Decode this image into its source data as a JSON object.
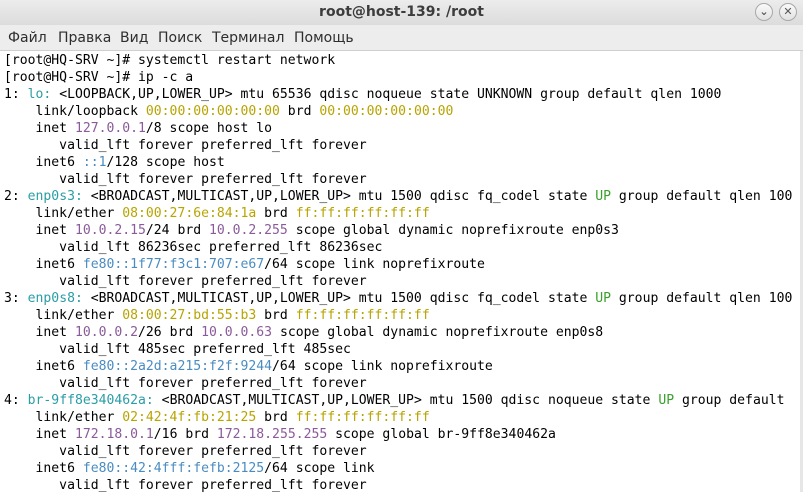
{
  "window": {
    "title": "root@host-139: /root"
  },
  "menu": [
    "Файл",
    "Правка",
    "Вид",
    "Поиск",
    "Терминал",
    "Помощь"
  ],
  "terminal": {
    "lines": [
      [
        [
          "",
          "[root@HQ-SRV ~]# systemctl restart network"
        ]
      ],
      [
        [
          "",
          "[root@HQ-SRV ~]# ip -c a"
        ]
      ],
      [
        [
          "",
          "1: "
        ],
        [
          "teal",
          "lo:"
        ],
        [
          "",
          " <LOOPBACK,UP,LOWER_UP> mtu 65536 qdisc noqueue state UNKNOWN group default qlen 1000"
        ]
      ],
      [
        [
          "",
          "    link/loopback "
        ],
        [
          "yellow",
          "00:00:00:00:00:00"
        ],
        [
          "",
          " brd "
        ],
        [
          "yellow",
          "00:00:00:00:00:00"
        ]
      ],
      [
        [
          "",
          "    inet "
        ],
        [
          "purple",
          "127.0.0.1"
        ],
        [
          "",
          "/8 scope host lo"
        ]
      ],
      [
        [
          "",
          "       valid_lft forever preferred_lft forever"
        ]
      ],
      [
        [
          "",
          "    inet6 "
        ],
        [
          "blue",
          "::1"
        ],
        [
          "",
          "/128 scope host"
        ]
      ],
      [
        [
          "",
          "       valid_lft forever preferred_lft forever"
        ]
      ],
      [
        [
          "",
          "2: "
        ],
        [
          "teal",
          "enp0s3:"
        ],
        [
          "",
          " <BROADCAST,MULTICAST,UP,LOWER_UP> mtu 1500 qdisc fq_codel state "
        ],
        [
          "green",
          "UP"
        ],
        [
          "",
          " group default qlen 100"
        ]
      ],
      [
        [
          "",
          "    link/ether "
        ],
        [
          "yellow",
          "08:00:27:6e:84:1a"
        ],
        [
          "",
          " brd "
        ],
        [
          "yellow",
          "ff:ff:ff:ff:ff:ff"
        ]
      ],
      [
        [
          "",
          "    inet "
        ],
        [
          "purple",
          "10.0.2.15"
        ],
        [
          "",
          "/24 brd "
        ],
        [
          "purple",
          "10.0.2.255"
        ],
        [
          "",
          " scope global dynamic noprefixroute enp0s3"
        ]
      ],
      [
        [
          "",
          "       valid_lft 86236sec preferred_lft 86236sec"
        ]
      ],
      [
        [
          "",
          "    inet6 "
        ],
        [
          "blue",
          "fe80::1f77:f3c1:707:e67"
        ],
        [
          "",
          "/64 scope link noprefixroute"
        ]
      ],
      [
        [
          "",
          "       valid_lft forever preferred_lft forever"
        ]
      ],
      [
        [
          "",
          "3: "
        ],
        [
          "teal",
          "enp0s8:"
        ],
        [
          "",
          " <BROADCAST,MULTICAST,UP,LOWER_UP> mtu 1500 qdisc fq_codel state "
        ],
        [
          "green",
          "UP"
        ],
        [
          "",
          " group default qlen 100"
        ]
      ],
      [
        [
          "",
          "    link/ether "
        ],
        [
          "yellow",
          "08:00:27:bd:55:b3"
        ],
        [
          "",
          " brd "
        ],
        [
          "yellow",
          "ff:ff:ff:ff:ff:ff"
        ]
      ],
      [
        [
          "",
          "    inet "
        ],
        [
          "purple",
          "10.0.0.2"
        ],
        [
          "",
          "/26 brd "
        ],
        [
          "purple",
          "10.0.0.63"
        ],
        [
          "",
          " scope global dynamic noprefixroute enp0s8"
        ]
      ],
      [
        [
          "",
          "       valid_lft 485sec preferred_lft 485sec"
        ]
      ],
      [
        [
          "",
          "    inet6 "
        ],
        [
          "blue",
          "fe80::2a2d:a215:f2f:9244"
        ],
        [
          "",
          "/64 scope link noprefixroute"
        ]
      ],
      [
        [
          "",
          "       valid_lft forever preferred_lft forever"
        ]
      ],
      [
        [
          "",
          "4: "
        ],
        [
          "teal",
          "br-9ff8e340462a:"
        ],
        [
          "",
          " <BROADCAST,MULTICAST,UP,LOWER_UP> mtu 1500 qdisc noqueue state "
        ],
        [
          "green",
          "UP"
        ],
        [
          "",
          " group default"
        ]
      ],
      [
        [
          "",
          "    link/ether "
        ],
        [
          "yellow",
          "02:42:4f:fb:21:25"
        ],
        [
          "",
          " brd "
        ],
        [
          "yellow",
          "ff:ff:ff:ff:ff:ff"
        ]
      ],
      [
        [
          "",
          "    inet "
        ],
        [
          "purple",
          "172.18.0.1"
        ],
        [
          "",
          "/16 brd "
        ],
        [
          "purple",
          "172.18.255.255"
        ],
        [
          "",
          " scope global br-9ff8e340462a"
        ]
      ],
      [
        [
          "",
          "       valid_lft forever preferred_lft forever"
        ]
      ],
      [
        [
          "",
          "    inet6 "
        ],
        [
          "blue",
          "fe80::42:4fff:fefb:2125"
        ],
        [
          "",
          "/64 scope link"
        ]
      ],
      [
        [
          "",
          "       valid_lft forever preferred_lft forever"
        ]
      ]
    ]
  }
}
